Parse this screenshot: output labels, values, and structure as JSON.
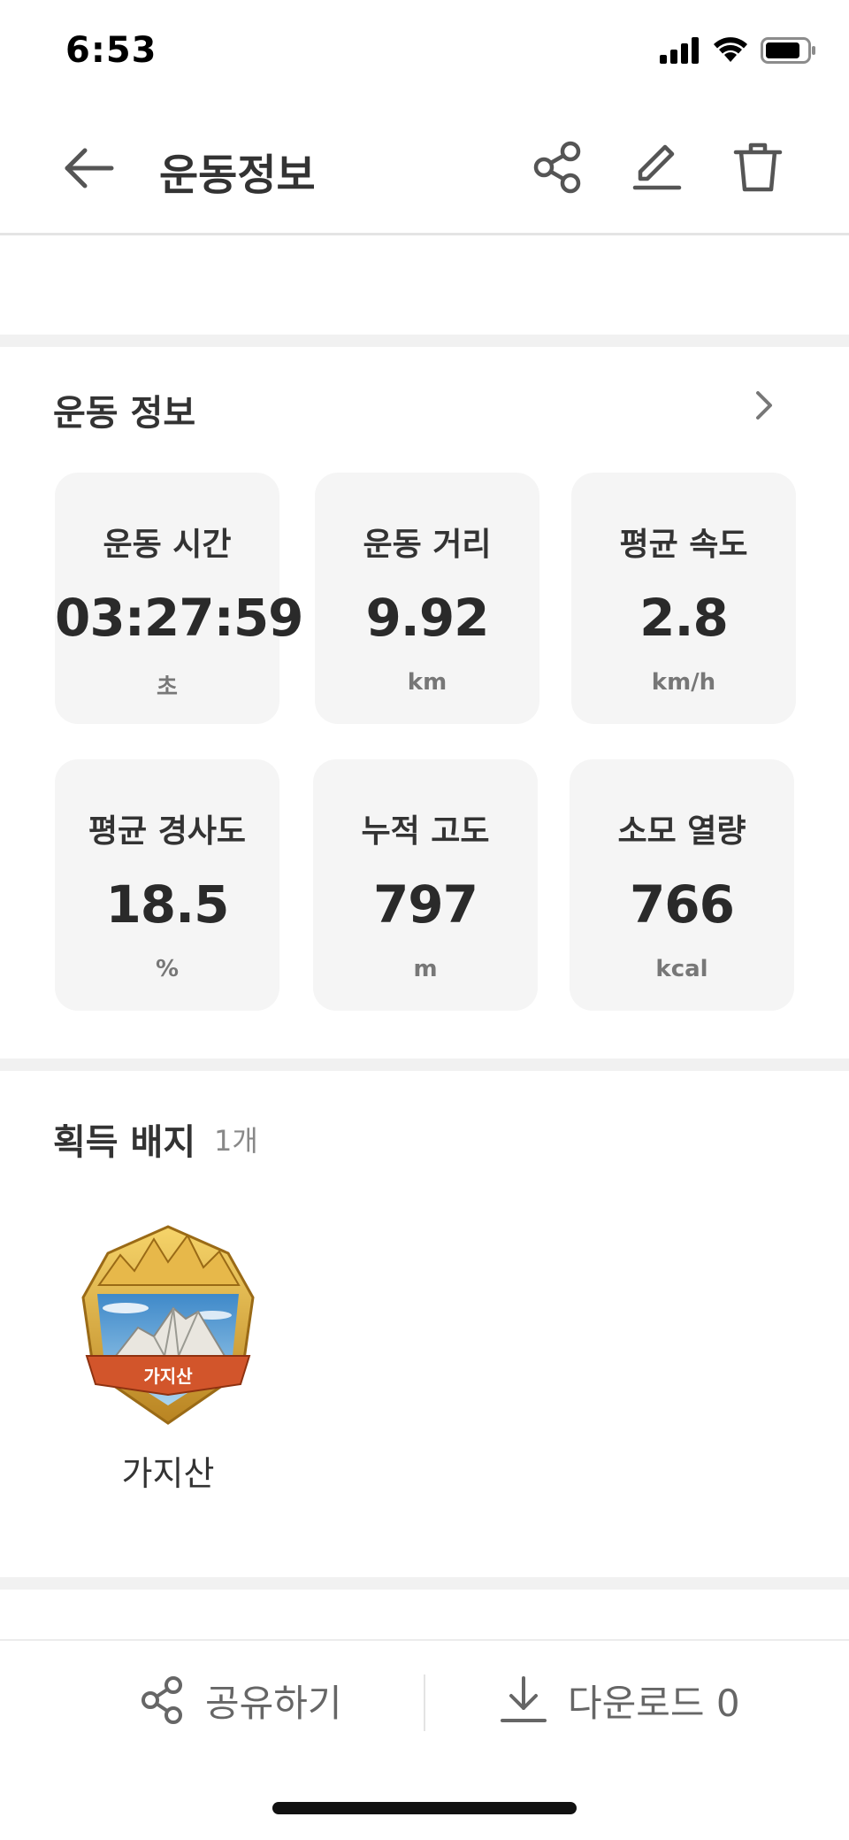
{
  "status_bar": {
    "time": "6:53",
    "icons": [
      "cellular-signal-icon",
      "wifi-icon",
      "battery-icon"
    ]
  },
  "header": {
    "title": "운동정보",
    "back_icon": "back-arrow-icon",
    "actions": [
      "share-icon",
      "edit-icon",
      "delete-icon"
    ]
  },
  "workout_info": {
    "section_title": "운동 정보",
    "stats": [
      {
        "label": "운동 시간",
        "value": "03:27:59",
        "unit": "초"
      },
      {
        "label": "운동 거리",
        "value": "9.92",
        "unit": "km"
      },
      {
        "label": "평균 속도",
        "value": "2.8",
        "unit": "km/h"
      },
      {
        "label": "평균 경사도",
        "value": "18.5",
        "unit": "%"
      },
      {
        "label": "누적 고도",
        "value": "797",
        "unit": "m"
      },
      {
        "label": "소모 열량",
        "value": "766",
        "unit": "kcal"
      }
    ]
  },
  "badges": {
    "section_title": "획득 배지",
    "count": "1개",
    "items": [
      {
        "name": "가지산",
        "emblem_text": "가지산"
      }
    ]
  },
  "bottom_bar": {
    "share_label": "공유하기",
    "download_label": "다운로드 0"
  },
  "colors": {
    "card_bg": "#f5f5f5",
    "divider": "#e4e4e4",
    "band": "#f1f1f1",
    "badge_gold": "#e3b33a",
    "badge_ribbon": "#d2552b"
  }
}
